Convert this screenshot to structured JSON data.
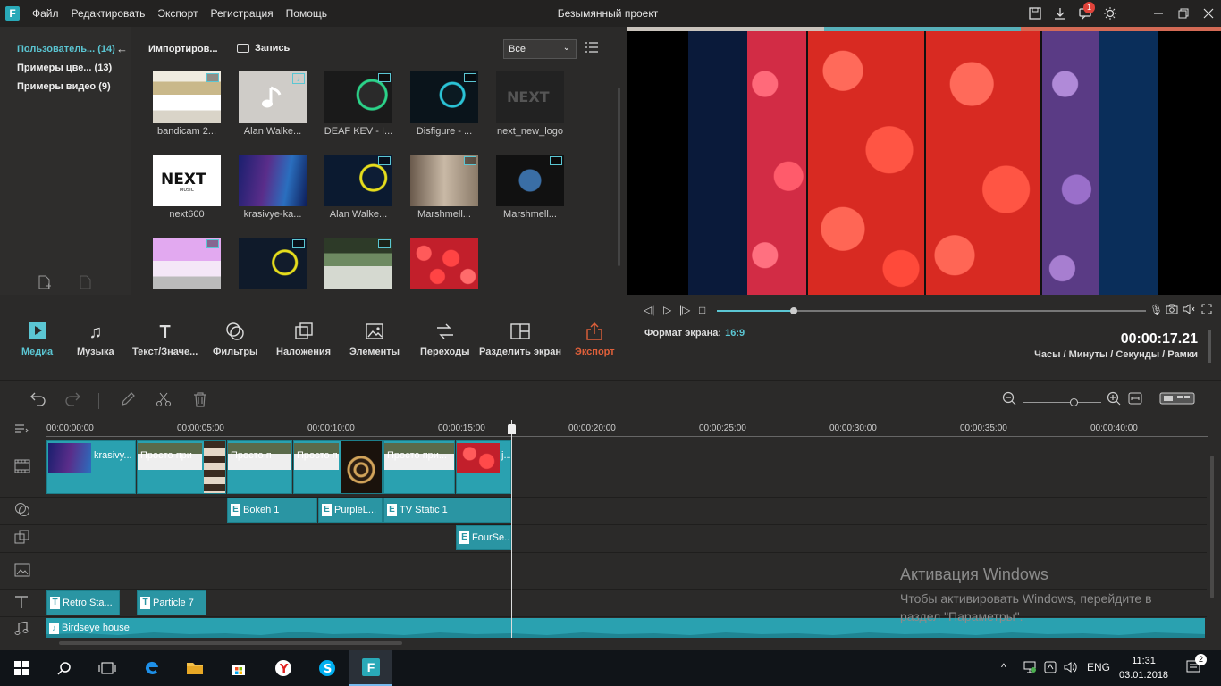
{
  "window": {
    "title": "Безымянный проект",
    "menu": [
      "Файл",
      "Редактировать",
      "Экспорт",
      "Регистрация",
      "Помощь"
    ],
    "notification_count": "1"
  },
  "library": {
    "items": [
      {
        "label": "Пользователь...",
        "count": "(14)",
        "active": true
      },
      {
        "label": "Примеры цве...",
        "count": "(13)",
        "active": false
      },
      {
        "label": "Примеры видео",
        "count": "(9)",
        "active": false
      }
    ]
  },
  "media": {
    "imported_label": "Импортиров...",
    "record_label": "Запись",
    "filter_value": "Все",
    "items": [
      {
        "caption": "bandicam 2...",
        "kind": "video"
      },
      {
        "caption": "Alan Walke...",
        "kind": "audio"
      },
      {
        "caption": "DEAF KEV - I...",
        "kind": "video"
      },
      {
        "caption": "Disfigure - ...",
        "kind": "video"
      },
      {
        "caption": "next_new_logo",
        "kind": "image"
      },
      {
        "caption": "next600",
        "kind": "image"
      },
      {
        "caption": "krasivye-ka...",
        "kind": "image"
      },
      {
        "caption": "Alan Walke...",
        "kind": "video"
      },
      {
        "caption": "Marshmell...",
        "kind": "video"
      },
      {
        "caption": "Marshmell...",
        "kind": "video"
      },
      {
        "caption": "",
        "kind": "video"
      },
      {
        "caption": "",
        "kind": "video"
      },
      {
        "caption": "",
        "kind": "video"
      },
      {
        "caption": "",
        "kind": "image"
      }
    ]
  },
  "toolbar": {
    "tools": [
      {
        "label": "Медиа",
        "icon": "media-icon"
      },
      {
        "label": "Музыка",
        "icon": "music-icon"
      },
      {
        "label": "Текст/Значе...",
        "icon": "text-icon"
      },
      {
        "label": "Фильтры",
        "icon": "filters-icon"
      },
      {
        "label": "Наложения",
        "icon": "overlays-icon"
      },
      {
        "label": "Элементы",
        "icon": "elements-icon"
      },
      {
        "label": "Переходы",
        "icon": "transitions-icon"
      },
      {
        "label": "Разделить экран",
        "icon": "split-screen-icon"
      },
      {
        "label": "Экспорт",
        "icon": "export-icon"
      }
    ]
  },
  "preview": {
    "aspect_label": "Формат экрана:",
    "aspect_value": "16:9",
    "timecode": "00:00:17.21",
    "time_units": "Часы / Минуты / Секунды / Рамки",
    "progress": 0.18
  },
  "timeline": {
    "ruler": [
      "00:00:00:00",
      "00:00:05:00",
      "00:00:10:00",
      "00:00:15:00",
      "00:00:20:00",
      "00:00:25:00",
      "00:00:30:00",
      "00:00:35:00",
      "00:00:40:00"
    ],
    "video_clips": [
      "krasivy...",
      "Просто при",
      "Просто п",
      "Просто п",
      "Просто при...",
      "j..."
    ],
    "filter_clips": [
      "Bokeh 1",
      "PurpleL...",
      "TV Static 1"
    ],
    "overlay_clips": [
      "FourSe..."
    ],
    "text_clips": [
      "Retro Sta...",
      "Particle 7"
    ],
    "audio_clip": "Birdseye house"
  },
  "watermark": {
    "line1": "Активация Windows",
    "line2": "Чтобы активировать Windows, перейдите в раздел \"Параметры\"."
  },
  "taskbar": {
    "lang": "ENG",
    "time": "11:31",
    "date": "03.01.2018",
    "notif_count": "2"
  },
  "colors": {
    "accent": "#5bc6d3",
    "clip": "#2aa1b0",
    "export": "#e0603a"
  }
}
